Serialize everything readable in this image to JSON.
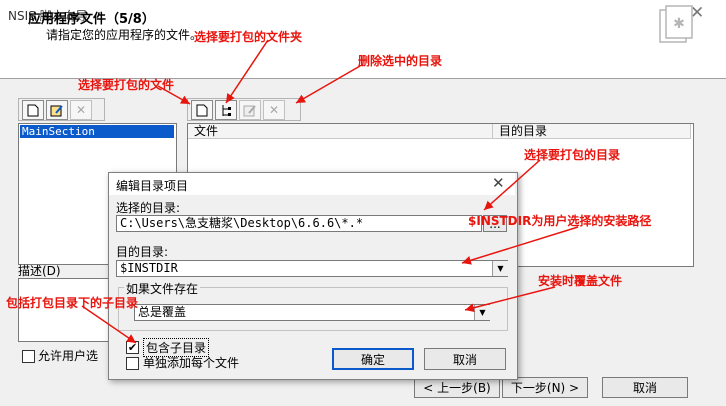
{
  "window": {
    "title": "NSIS 脚本向导",
    "close_glyph": "✕"
  },
  "header": {
    "title": "应用程序文件（5/8）",
    "subtitle": "请指定您的应用程序的文件。"
  },
  "left_panel": {
    "sections": [
      "MainSection"
    ],
    "description_label": "描述(D)"
  },
  "file_list": {
    "columns": [
      "文件",
      "目的目录"
    ]
  },
  "footer": {
    "allow_user_label": "允许用户选",
    "prev_button": "< 上一步(B)",
    "next_button": "下一步(N) >",
    "cancel_button": "取消"
  },
  "dialog": {
    "title": "编辑目录项目",
    "close_glyph": "✕",
    "select_dir_label": "选择的目录:",
    "select_dir_value": "C:\\Users\\急支糖浆\\Desktop\\6.6.6\\*.*",
    "browse_button": "...",
    "dest_dir_label": "目的目录:",
    "dest_dir_value": "$INSTDIR",
    "if_exists_group": "如果文件存在",
    "if_exists_value": "总是覆盖",
    "include_subdirs_label": "包含子目录",
    "include_subdirs_checked": true,
    "add_each_file_label": "单独添加每个文件",
    "add_each_file_checked": false,
    "ok_button": "确定",
    "cancel_button": "取消"
  },
  "annotations": {
    "select_folder": "选择要打包的文件夹",
    "delete_dir": "删除选中的目录",
    "select_file": "选择要打包的文件",
    "select_dir": "选择要打包的目录",
    "instdir_note": "$INSTDIR为用户选择的安装路径",
    "overwrite_note": "安装时覆盖文件",
    "include_subdirs_note": "包括打包目录下的子目录",
    "color": "#e8150e"
  }
}
